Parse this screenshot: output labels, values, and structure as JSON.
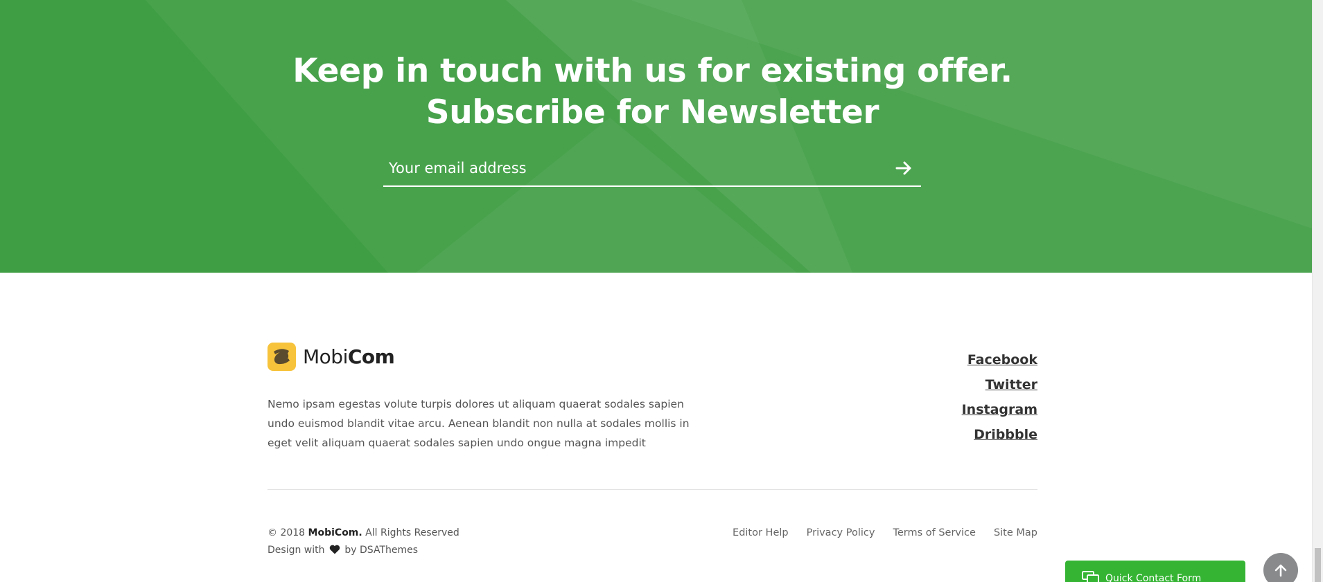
{
  "newsletter": {
    "title_line1": "Keep in touch with us for existing offer.",
    "title_line2": "Subscribe for Newsletter",
    "email_placeholder": "Your email address",
    "submit_icon": "arrow-right-icon"
  },
  "footer": {
    "logo_mark_icon": "mobicom-logo-icon",
    "logo_light": "Mobi",
    "logo_bold": "Com",
    "about": "Nemo ipsam egestas volute turpis dolores ut aliquam quaerat sodales sapien undo euismod blandit vitae arcu. Aenean blandit non nulla at sodales mollis in eget velit aliquam quaerat sodales sapien undo ongue magna impedit",
    "social": [
      "Facebook",
      "Twitter",
      "Instagram",
      "Dribbble"
    ],
    "copyright_prefix": "© 2018",
    "copyright_brand": "MobiCom.",
    "copyright_suffix": "All Rights Reserved",
    "design_prefix": "Design with",
    "design_suffix": "by DSAThemes",
    "heart_icon": "heart-icon",
    "links": [
      "Editor Help",
      "Privacy Policy",
      "Terms of Service",
      "Site Map"
    ]
  },
  "widgets": {
    "quick_contact": "Quick Contact Form",
    "quick_contact_icon": "chat-icon",
    "back_to_top_icon": "arrow-up-icon"
  },
  "colors": {
    "hero_green": "#3f9e43",
    "logo_yellow": "#f6c33b",
    "widget_green": "#35b434"
  }
}
